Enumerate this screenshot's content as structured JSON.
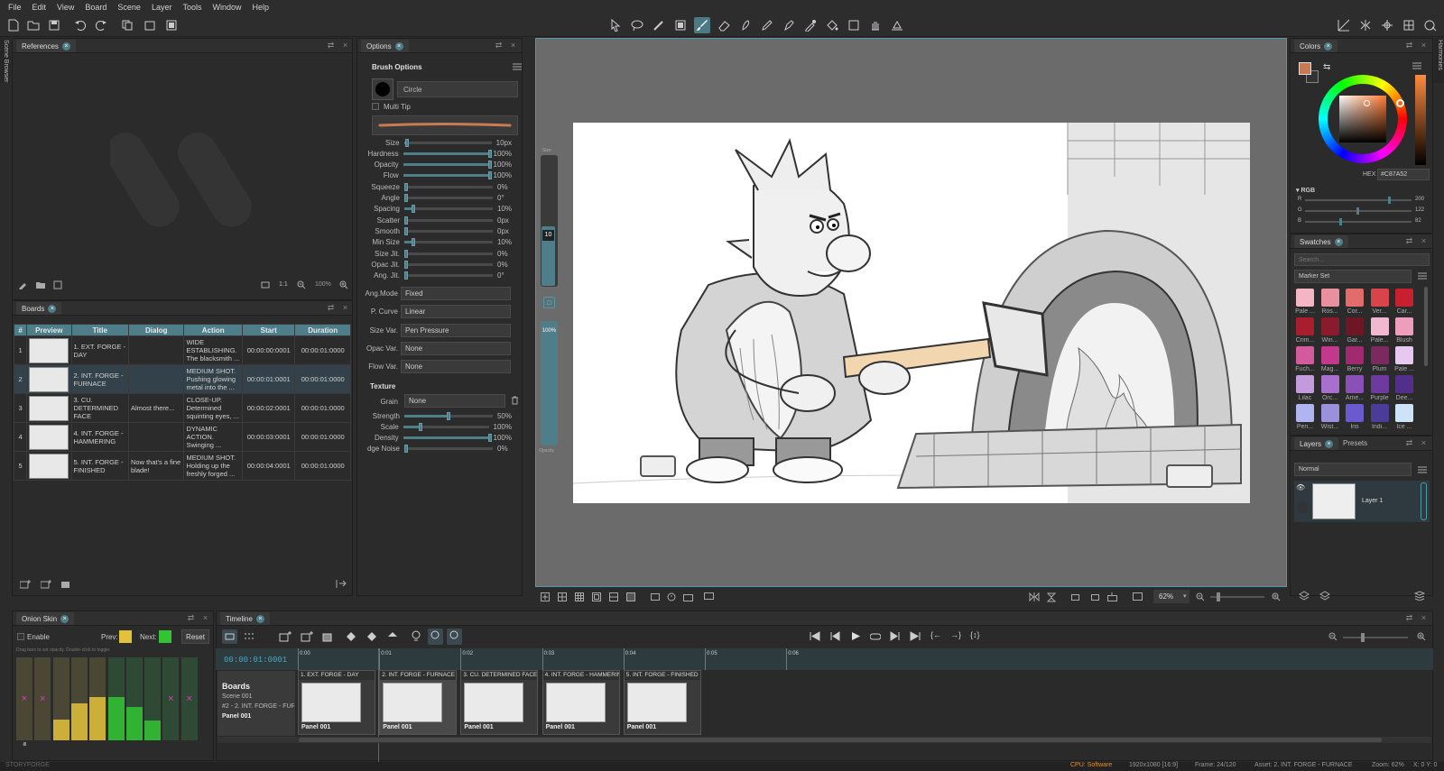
{
  "menu": [
    "File",
    "Edit",
    "View",
    "Board",
    "Scene",
    "Layer",
    "Tools",
    "Window",
    "Help"
  ],
  "panels": {
    "references": {
      "title": "References",
      "zoom_fit": "1:1",
      "zoom": "100%"
    },
    "boards": {
      "title": "Boards",
      "columns": [
        "#",
        "Preview",
        "Title",
        "Dialog",
        "Action",
        "Start",
        "Duration"
      ],
      "rows": [
        {
          "num": "1",
          "title": "1. EXT. FORGE - DAY",
          "dialog": "",
          "action": "WIDE ESTABLISHING. The blacksmith ...",
          "start": "00:00:00:0001",
          "duration": "00:00:01:0000"
        },
        {
          "num": "2",
          "title": "2. INT. FORGE - FURNACE",
          "dialog": "",
          "action": "MEDIUM SHOT. Pushing glowing metal into the ...",
          "start": "00:00:01:0001",
          "duration": "00:00:01:0000"
        },
        {
          "num": "3",
          "title": "3. CU. DETERMINED FACE",
          "dialog": "Almost there...",
          "action": "CLOSE-UP. Determined squinting eyes, ...",
          "start": "00:00:02:0001",
          "duration": "00:00:01:0000"
        },
        {
          "num": "4",
          "title": "4. INT. FORGE - HAMMERING",
          "dialog": "",
          "action": "DYNAMIC ACTION. Swinging ...",
          "start": "00:00:03:0001",
          "duration": "00:00:01:0000"
        },
        {
          "num": "5",
          "title": "5. INT. FORGE - FINISHED",
          "dialog": "Now that's a fine blade!",
          "action": "MEDIUM SHOT. Holding up the freshly forged ...",
          "start": "00:00:04:0001",
          "duration": "00:00:01:0000"
        }
      ]
    },
    "options": {
      "title": "Options",
      "section": "Brush Options",
      "brush_shape": "Circle",
      "multi_tip": "Multi Tip",
      "sliders": [
        {
          "label": "Size",
          "value": "10px",
          "level": 0.03
        },
        {
          "label": "Hardness",
          "value": "100%",
          "level": 1.0
        },
        {
          "label": "Opacity",
          "value": "100%",
          "level": 1.0
        },
        {
          "label": "Flow",
          "value": "100%",
          "level": 1.0
        },
        {
          "label": "Squeeze",
          "value": "0%",
          "level": 0.0
        },
        {
          "label": "Angle",
          "value": "0°",
          "level": 0.0
        },
        {
          "label": "Spacing",
          "value": "10%",
          "level": 0.1
        },
        {
          "label": "Scatter",
          "value": "0px",
          "level": 0.0
        },
        {
          "label": "Smooth",
          "value": "0px",
          "level": 0.0
        },
        {
          "label": "Min Size",
          "value": "10%",
          "level": 0.1
        },
        {
          "label": "Size Jit.",
          "value": "0%",
          "level": 0.0
        },
        {
          "label": "Opac Jit.",
          "value": "0%",
          "level": 0.0
        },
        {
          "label": "Ang. Jit.",
          "value": "0°",
          "level": 0.0
        }
      ],
      "selects": [
        {
          "label": "Ang.Mode",
          "value": "Fixed"
        },
        {
          "label": "P. Curve",
          "value": "Linear"
        },
        {
          "label": "Size Var.",
          "value": "Pen Pressure"
        },
        {
          "label": "Opac Var.",
          "value": "None"
        },
        {
          "label": "Flow Var.",
          "value": "None"
        }
      ],
      "texture": "Texture",
      "grain_label": "Grain",
      "grain_value": "None",
      "texture_sliders": [
        {
          "label": "Strength",
          "value": "50%",
          "level": 0.5
        },
        {
          "label": "Scale",
          "value": "100%",
          "level": 0.2
        },
        {
          "label": "Density",
          "value": "100%",
          "level": 1.0
        },
        {
          "label": "dge Noise",
          "value": "0%",
          "level": 0.0
        }
      ]
    },
    "canvas": {
      "size_label": "Size",
      "size_value": "10",
      "opacity_value": "100%",
      "opacity_label": "Opacity",
      "zoom": "62%"
    },
    "colors": {
      "title": "Colors",
      "hex_label": "HEX",
      "hex_value": "#C87A52",
      "rgb_label": "RGB",
      "r_label": "R",
      "r": "200",
      "g_label": "G",
      "g": "122",
      "b_label": "B",
      "b": "82",
      "primary": "#C87A52"
    },
    "swatches": {
      "title": "Swatches",
      "search_placeholder": "Search...",
      "set": "Marker Set",
      "items": [
        {
          "name": "Pale ...",
          "color": "#F4B6C2"
        },
        {
          "name": "Ros...",
          "color": "#E8909E"
        },
        {
          "name": "Cor...",
          "color": "#E26B6B"
        },
        {
          "name": "Ver...",
          "color": "#D9434A"
        },
        {
          "name": "Car...",
          "color": "#C8202E"
        },
        {
          "name": "Crim...",
          "color": "#A81E2E"
        },
        {
          "name": "Win...",
          "color": "#8A1A2C"
        },
        {
          "name": "Gar...",
          "color": "#6E1626"
        },
        {
          "name": "Pale...",
          "color": "#F2B8D0"
        },
        {
          "name": "Blush",
          "color": "#EE9EBB"
        },
        {
          "name": "Fuch...",
          "color": "#D45A9E"
        },
        {
          "name": "Mag...",
          "color": "#C2388A"
        },
        {
          "name": "Berry",
          "color": "#A02A70"
        },
        {
          "name": "Plum",
          "color": "#7A2A5E"
        },
        {
          "name": "Pale ...",
          "color": "#E6C8F0"
        },
        {
          "name": "Lilac",
          "color": "#C49ADE"
        },
        {
          "name": "Orc...",
          "color": "#A870CC"
        },
        {
          "name": "Ame...",
          "color": "#8A50B8"
        },
        {
          "name": "Purple",
          "color": "#6E3AA0"
        },
        {
          "name": "Dee...",
          "color": "#52308A"
        },
        {
          "name": "Peri...",
          "color": "#B0B4F0"
        },
        {
          "name": "Wist...",
          "color": "#9A90DC"
        },
        {
          "name": "Iris",
          "color": "#6A5ACD"
        },
        {
          "name": "Indi...",
          "color": "#4B3C9A"
        },
        {
          "name": "Ice ...",
          "color": "#CCE4F6"
        }
      ]
    },
    "layers": {
      "title": "Layers",
      "presets_tab": "Presets",
      "blend": "Normal",
      "layer_name": "Layer 1"
    },
    "onion": {
      "title": "Onion Skin",
      "enable": "Enable",
      "prev": "Prev:",
      "next": "Next:",
      "reset": "Reset",
      "hint": "Drag bars to set opacity. Double-click to toggle.",
      "prev_color": "#E2C23A",
      "next_color": "#33C433",
      "bars": [
        {
          "label": "-5",
          "level": 0,
          "kind": "prev",
          "off": true
        },
        {
          "label": "-4",
          "level": 0,
          "kind": "prev",
          "off": true
        },
        {
          "label": "-3",
          "level": 0.25,
          "kind": "prev",
          "off": false
        },
        {
          "label": "-2",
          "level": 0.45,
          "kind": "prev",
          "off": false
        },
        {
          "label": "-1",
          "level": 0.52,
          "kind": "prev",
          "off": false
        },
        {
          "label": "1",
          "level": 0.52,
          "kind": "next",
          "off": false
        },
        {
          "label": "2",
          "level": 0.4,
          "kind": "next",
          "off": false
        },
        {
          "label": "3",
          "level": 0.24,
          "kind": "next",
          "off": false
        },
        {
          "label": "4",
          "level": 0,
          "kind": "next",
          "off": true
        },
        {
          "label": "5",
          "level": 0,
          "kind": "next",
          "off": true
        }
      ]
    },
    "timeline": {
      "title": "Timeline",
      "timecode": "00:00:01:0001",
      "ruler": [
        "0:00",
        "0:01",
        "0:02",
        "0:03",
        "0:04",
        "0:05",
        "0:06"
      ],
      "track": {
        "name": "Boards",
        "scene": "Scene 001",
        "board": "#2 - 2. INT. FORGE - FUR",
        "panel": "Panel 001"
      },
      "clips": [
        {
          "title": "1. EXT. FORGE - DAY",
          "panel": "Panel 001"
        },
        {
          "title": "2. INT. FORGE - FURNACE",
          "panel": "Panel 001"
        },
        {
          "title": "3. CU. DETERMINED FACE",
          "panel": "Panel 001"
        },
        {
          "title": "4. INT. FORGE - HAMMERING",
          "panel": "Panel 001"
        },
        {
          "title": "5. INT. FORGE - FINISHED",
          "panel": "Panel 001"
        }
      ]
    }
  },
  "side_tabs": {
    "left": "Scene Browser",
    "right": "Harmonies"
  },
  "status": {
    "app": "STORYFORGE",
    "cpu": "CPU: Software",
    "resolution": "1920x1080 [16:9]",
    "frame": "Frame: 24/120",
    "asset": "Asset: 2. INT. FORGE - FURNACE",
    "zoom": "Zoom: 62%",
    "coords": "X: 0 Y: 0"
  }
}
